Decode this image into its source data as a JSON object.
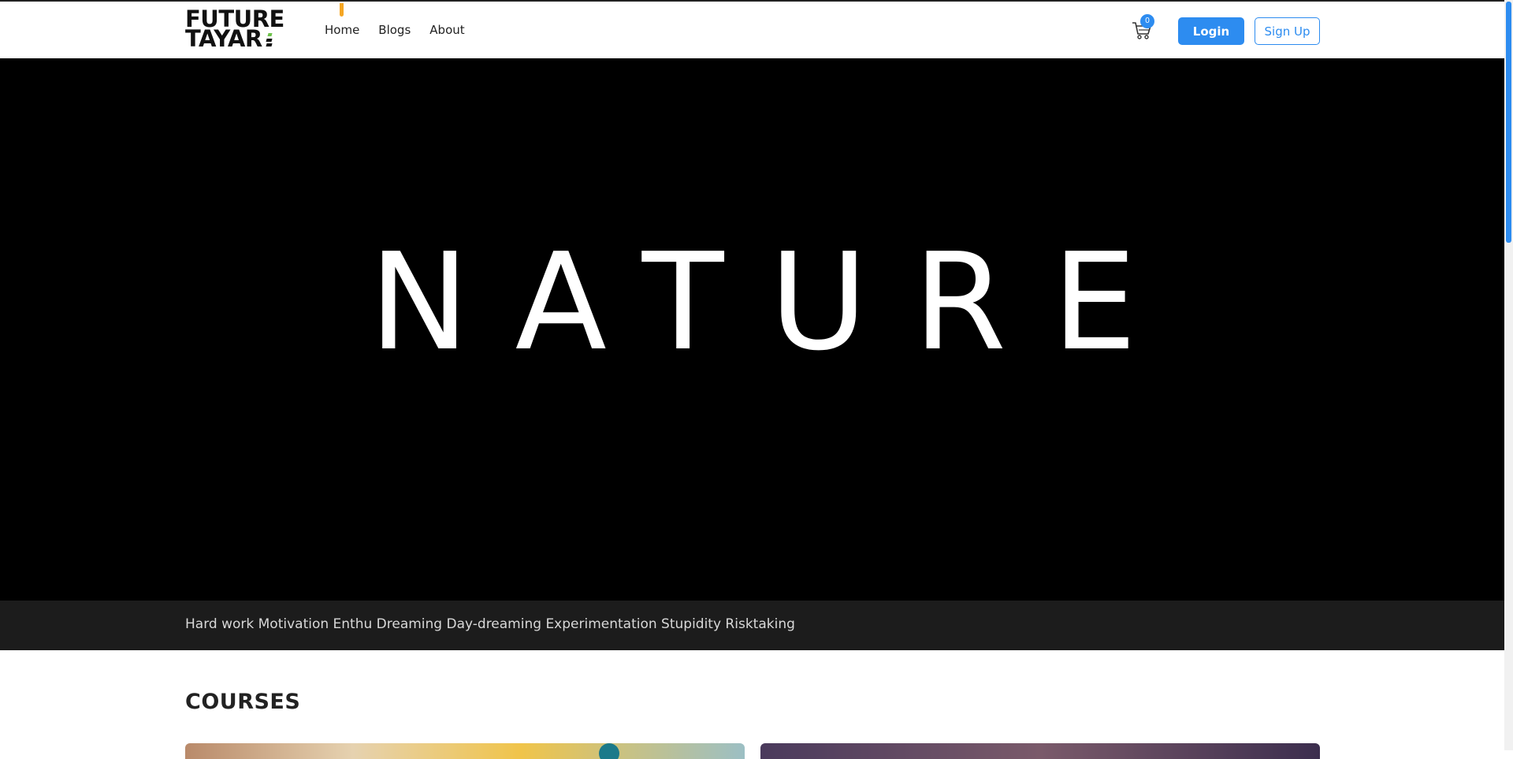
{
  "brand": {
    "line1": "FUTURE",
    "line2": "TAYAR",
    "accent_color": "#6cc14a"
  },
  "nav": {
    "items": [
      {
        "label": "Home"
      },
      {
        "label": "Blogs"
      },
      {
        "label": "About"
      }
    ],
    "active_indicator_color": "#f5a623"
  },
  "cart": {
    "icon": "cart-icon",
    "count": "0"
  },
  "auth": {
    "login_label": "Login",
    "signup_label": "Sign Up",
    "primary_color": "#2d8cf0"
  },
  "hero": {
    "title": "NATURE",
    "background": "#000000"
  },
  "ticker": {
    "text": "Hard work Motivation Enthu Dreaming Day-dreaming Experimentation Stupidity Risktaking"
  },
  "courses": {
    "heading": "COURSES"
  }
}
